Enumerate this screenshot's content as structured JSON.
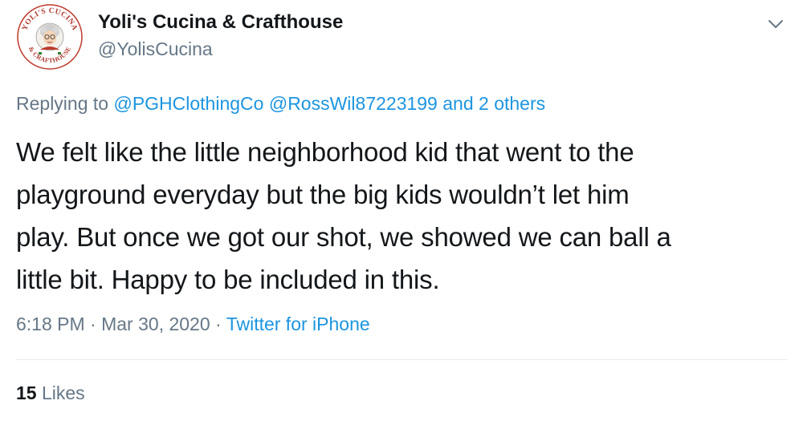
{
  "author": {
    "display_name": "Yoli's Cucina & Crafthouse",
    "handle": "@YolisCucina",
    "avatar": {
      "icon": "restaurant-logo-icon",
      "logo_text_top": "YOLI'S CUCINA",
      "logo_text_bottom": "& CRAFTHOUSE",
      "ring_color": "#c0392b"
    }
  },
  "reply": {
    "prefix": "Replying to",
    "mentions": [
      "@PGHClothingCo",
      "@RossWil87223199"
    ],
    "and_others": "and 2 others"
  },
  "tweet": {
    "lines": [
      "We felt like the little neighborhood kid that went to the",
      "playground everyday but the big kids wouldn’t let him",
      "play. But once we got our shot, we showed we can ball a",
      "little bit. Happy to be included in this."
    ]
  },
  "meta": {
    "time": "6:18 PM",
    "separator": "·",
    "date": "Mar 30, 2020",
    "source": "Twitter for iPhone"
  },
  "stats": {
    "likes_count": "15",
    "likes_label": "Likes"
  },
  "colors": {
    "link": "#1b95e0",
    "secondary_text": "#657786",
    "primary_text": "#14171a"
  }
}
